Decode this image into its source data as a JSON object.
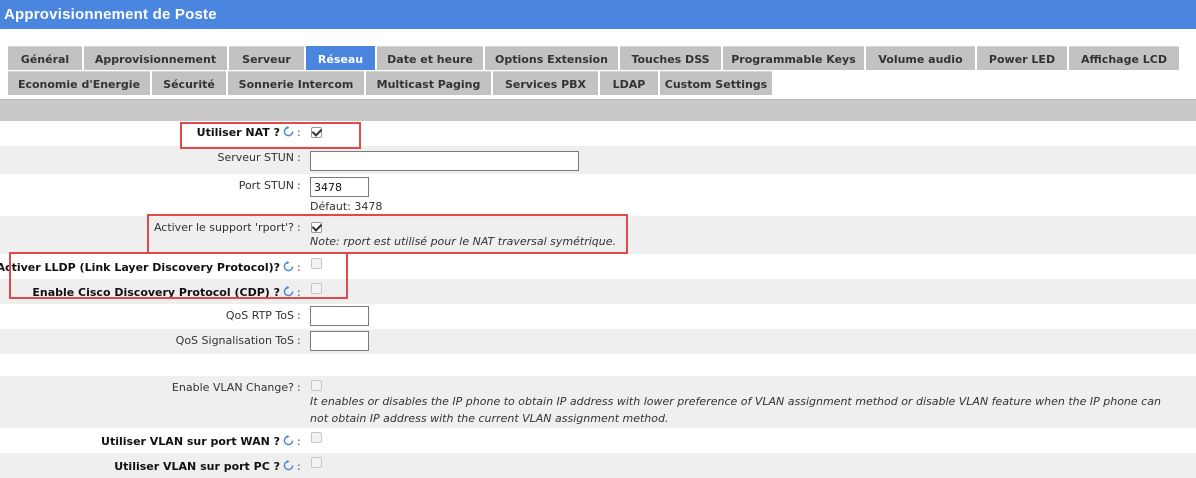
{
  "window": {
    "title": "Approvisionnement de Poste"
  },
  "tabs": {
    "row1": [
      "Général",
      "Approvisionnement",
      "Serveur",
      "Réseau",
      "Date et heure",
      "Options Extension",
      "Touches DSS",
      "Programmable Keys",
      "Volume audio",
      "Power LED",
      "Affichage LCD"
    ],
    "row2": [
      "Economie d'Energie",
      "Sécurité",
      "Sonnerie Intercom",
      "Multicast Paging",
      "Services PBX",
      "LDAP",
      "Custom Settings"
    ],
    "active": "Réseau"
  },
  "form": {
    "nat": {
      "label": "Utiliser NAT ?",
      "checked": true
    },
    "stun_server": {
      "label": "Serveur STUN",
      "value": ""
    },
    "stun_port": {
      "label": "Port STUN",
      "value": "3478",
      "default": "Défaut: 3478"
    },
    "rport": {
      "label": "Activer le support 'rport'?",
      "checked": true,
      "note": "Note: rport est utilisé pour le NAT traversal symétrique."
    },
    "lldp": {
      "label": "Activer LLDP (Link Layer Discovery Protocol)?",
      "checked": false
    },
    "cdp": {
      "label": "Enable Cisco Discovery Protocol (CDP) ?",
      "checked": false
    },
    "qos_rtp": {
      "label": "QoS RTP ToS",
      "value": ""
    },
    "qos_sig": {
      "label": "QoS Signalisation ToS",
      "value": ""
    },
    "vlan_change": {
      "label": "Enable VLAN Change?",
      "checked": false,
      "note": "It enables or disables the IP phone to obtain IP address with lower preference of VLAN assignment method or disable VLAN feature when the IP phone can not obtain IP address with the current VLAN assignment method."
    },
    "vlan_wan": {
      "label": "Utiliser VLAN sur port WAN ?",
      "checked": false
    },
    "vlan_pc": {
      "label": "Utiliser VLAN sur port PC ?",
      "checked": false
    },
    "colon": ":"
  },
  "colors": {
    "accent": "#4a86e0",
    "highlight": "#e04a4a"
  }
}
